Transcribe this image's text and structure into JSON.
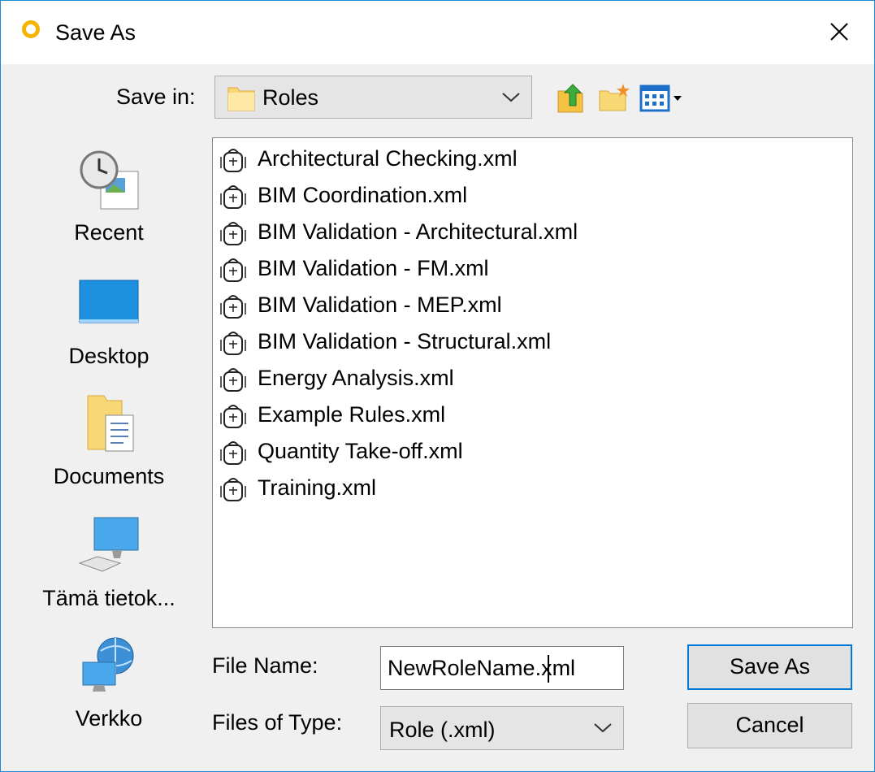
{
  "window": {
    "title": "Save As",
    "close_icon": "close-icon",
    "app_icon": "circle-icon",
    "accent": "#0078d7"
  },
  "toolbar": {
    "save_in_label": "Save in:",
    "location": "Roles",
    "buttons": [
      {
        "name": "up-folder-icon"
      },
      {
        "name": "new-folder-icon"
      },
      {
        "name": "view-menu-icon"
      }
    ]
  },
  "places": [
    {
      "label": "Recent",
      "icon": "recent-icon"
    },
    {
      "label": "Desktop",
      "icon": "desktop-icon"
    },
    {
      "label": "Documents",
      "icon": "documents-icon"
    },
    {
      "label": "Tämä tietok...",
      "icon": "computer-icon"
    },
    {
      "label": "Verkko",
      "icon": "network-icon"
    }
  ],
  "files": [
    "Architectural Checking.xml",
    "BIM Coordination.xml",
    "BIM Validation - Architectural.xml",
    "BIM Validation - FM.xml",
    "BIM Validation - MEP.xml",
    "BIM Validation - Structural.xml",
    "Energy Analysis.xml",
    "Example Rules.xml",
    "Quantity Take-off.xml",
    "Training.xml"
  ],
  "form": {
    "file_name_label": "File Name:",
    "file_name_value": "NewRoleName.xml",
    "file_type_label": "Files of Type:",
    "file_type_value": "Role (.xml)"
  },
  "buttons": {
    "save": "Save As",
    "cancel": "Cancel"
  }
}
